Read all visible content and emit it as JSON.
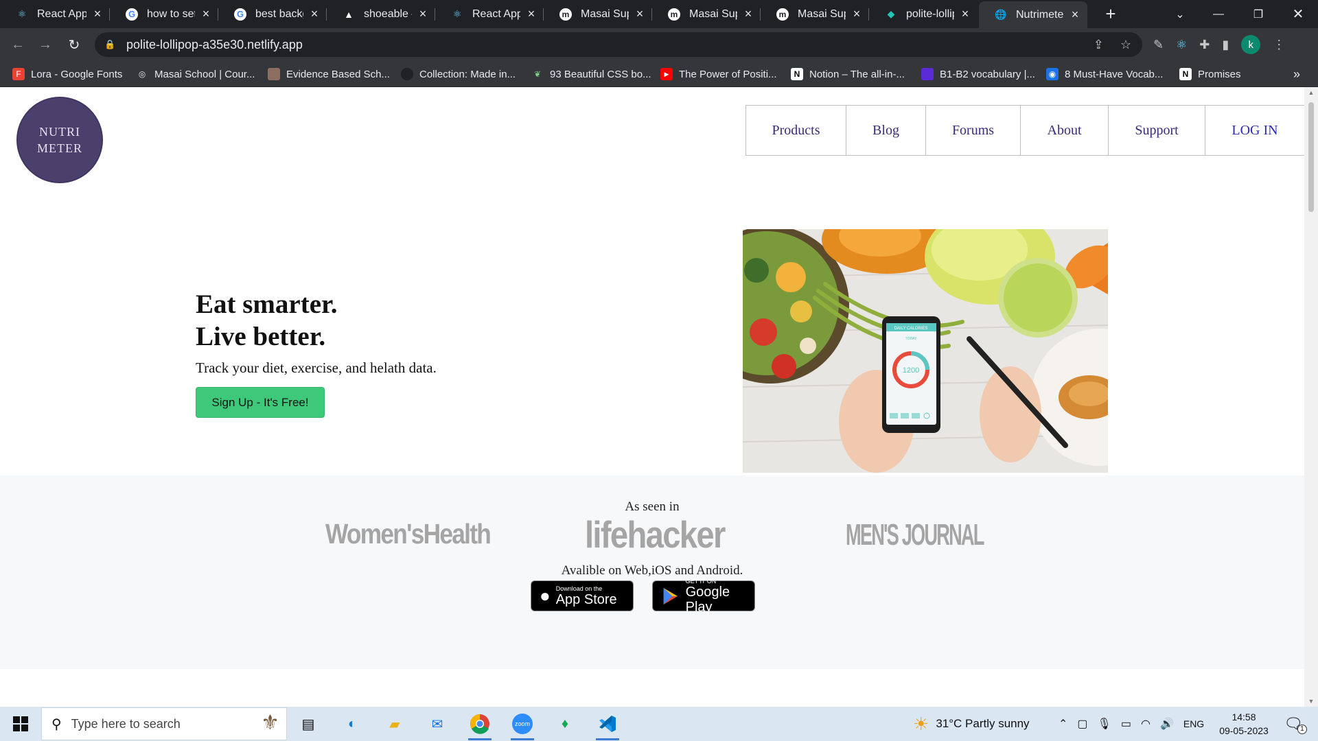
{
  "browser": {
    "tabs": [
      {
        "label": "React App",
        "icon": "react-icon"
      },
      {
        "label": "how to set c",
        "icon": "google-icon"
      },
      {
        "label": "best backgr",
        "icon": "google-icon"
      },
      {
        "label": "shoeable – I",
        "icon": "netlify-icon"
      },
      {
        "label": "React App",
        "icon": "react-icon"
      },
      {
        "label": "Masai Supp",
        "icon": "masai-icon"
      },
      {
        "label": "Masai Supp",
        "icon": "masai-icon"
      },
      {
        "label": "Masai Supp",
        "icon": "masai-icon"
      },
      {
        "label": "polite-lollip",
        "icon": "netlify-icon"
      },
      {
        "label": "Nutrimeter",
        "icon": "globe-icon",
        "active": true
      }
    ],
    "tab_close": "×",
    "new_tab": "+",
    "url": "polite-lollipop-a35e30.netlify.app",
    "profile_initial": "k",
    "bookmarks": [
      {
        "label": "Lora - Google Fonts",
        "color": "#ea4335"
      },
      {
        "label": "Masai School | Cour...",
        "color": "#5f6368"
      },
      {
        "label": "Evidence Based Sch...",
        "color": "#8d6e63"
      },
      {
        "label": "Collection: Made in...",
        "color": "#202124"
      },
      {
        "label": "93 Beautiful CSS bo...",
        "color": "#2e7d32"
      },
      {
        "label": "The Power of Positi...",
        "color": "#ff0000"
      },
      {
        "label": "Notion – The all-in-...",
        "color": "#ffffff"
      },
      {
        "label": "B1-B2 vocabulary |...",
        "color": "#5b2bd6"
      },
      {
        "label": "8 Must-Have Vocab...",
        "color": "#1a73e8"
      },
      {
        "label": "Promises",
        "color": "#ffffff"
      }
    ],
    "bookmarks_more": "»"
  },
  "site": {
    "logo_line1": "NUTRI",
    "logo_line2": "METER",
    "nav": [
      "Products",
      "Blog",
      "Forums",
      "About",
      "Support",
      "LOG IN"
    ],
    "hero_title_1": "Eat smarter.",
    "hero_title_2": "Live better.",
    "hero_subtitle": "Track your diet, exercise, and helath data.",
    "signup_label": "Sign Up - It's Free!",
    "phone_label": "DAILY CALORIES",
    "phone_today": "TODAY",
    "phone_value": "1200",
    "as_seen_in": "As seen in",
    "press": [
      "Women'sHealth",
      "lifehacker",
      "MEN'S JOURNAL"
    ],
    "available": "Avalible on Web,iOS and Android.",
    "appstore_small": "Download on the",
    "appstore_big": "App Store",
    "googleplay_small": "GET IT ON",
    "googleplay_big": "Google Play"
  },
  "taskbar": {
    "search_placeholder": "Type here to search",
    "weather": "31°C  Partly sunny",
    "language": "ENG",
    "time": "14:58",
    "date": "09-05-2023",
    "notifications": "1"
  }
}
